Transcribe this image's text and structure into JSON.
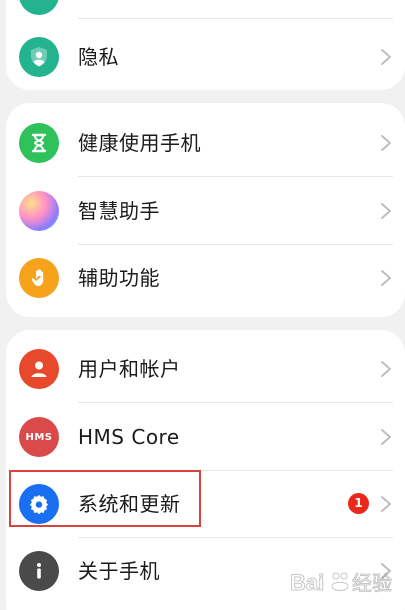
{
  "groups": [
    {
      "items": [
        {
          "label": "",
          "icon": "circle-icon",
          "color": "#23b38f"
        },
        {
          "label": "隐私",
          "icon": "shield-icon",
          "color": "#23b38f"
        }
      ]
    },
    {
      "items": [
        {
          "label": "健康使用手机",
          "icon": "hourglass-icon",
          "color": "#2fc25b"
        },
        {
          "label": "智慧助手",
          "icon": "assistant-orb-icon",
          "color": "#f27ac0"
        },
        {
          "label": "辅助功能",
          "icon": "hand-icon",
          "color": "#f7a21b"
        }
      ]
    },
    {
      "items": [
        {
          "label": "用户和帐户",
          "icon": "user-icon",
          "color": "#e8482b"
        },
        {
          "label": "HMS Core",
          "icon": "hms-logo-icon",
          "color": "#db4a4a",
          "icon_text": "HMS"
        },
        {
          "label": "系统和更新",
          "icon": "gear-icon",
          "color": "#1a6ef0",
          "badge": "1"
        },
        {
          "label": "关于手机",
          "icon": "info-icon",
          "color": "#4a4a4a"
        }
      ]
    }
  ],
  "watermark": {
    "text": "Bai 经验",
    "brand": "baidu-watermark"
  }
}
